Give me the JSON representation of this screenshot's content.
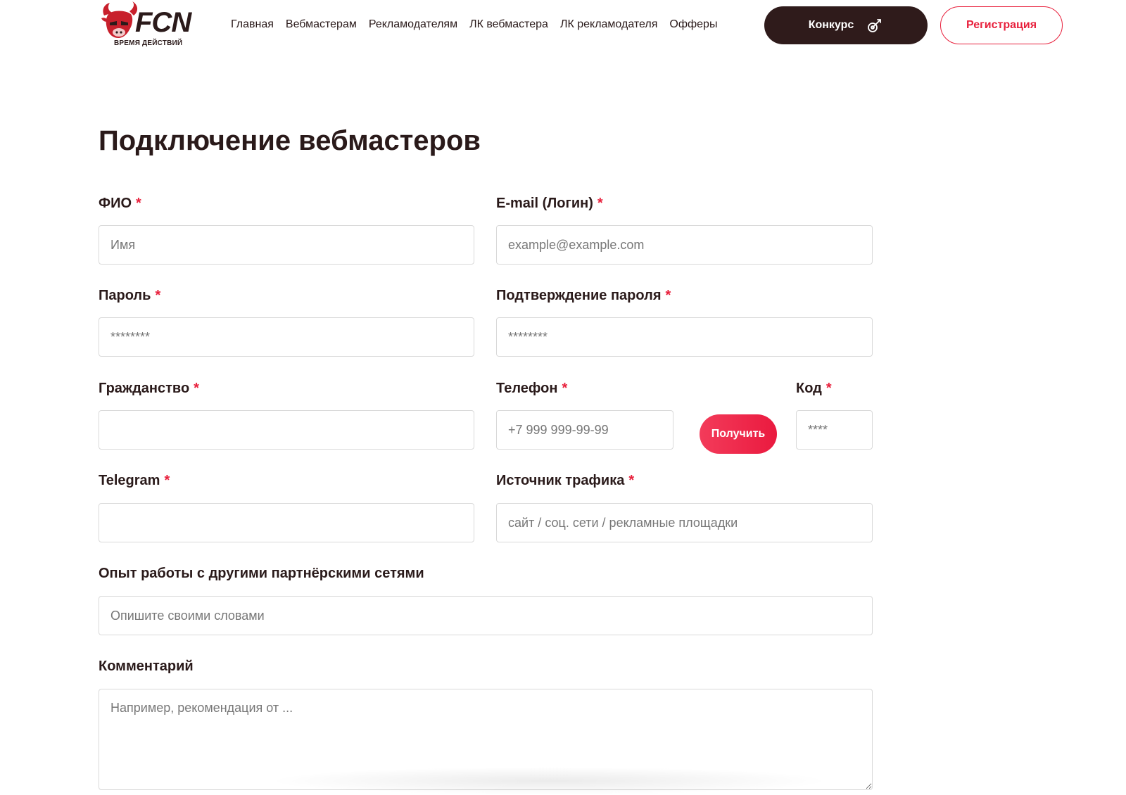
{
  "header": {
    "logo_text": "FCN",
    "logo_sub": "ВРЕМЯ ДЕЙСТВИЙ",
    "nav": [
      {
        "label": "Главная"
      },
      {
        "label": "Вебмастерам"
      },
      {
        "label": "Рекламодателям"
      },
      {
        "label": "ЛК вебмастера"
      },
      {
        "label": "ЛК рекламодателя"
      },
      {
        "label": "Офферы"
      }
    ],
    "contest_label": "Конкурс",
    "register_label": "Регистрация"
  },
  "page": {
    "title": "Подключение вебмастеров"
  },
  "form": {
    "required_mark": "*",
    "fio": {
      "label": "ФИО",
      "placeholder": "Имя",
      "value": ""
    },
    "email": {
      "label": "E-mail (Логин)",
      "placeholder": "example@example.com",
      "value": ""
    },
    "password": {
      "label": "Пароль",
      "placeholder": "********",
      "value": ""
    },
    "password_confirm": {
      "label": "Подтверждение пароля",
      "placeholder": "********",
      "value": ""
    },
    "citizenship": {
      "label": "Гражданство",
      "placeholder": "",
      "value": ""
    },
    "phone": {
      "label": "Телефон",
      "placeholder": "+7 999 999-99-99",
      "value": ""
    },
    "get_code_label": "Получить",
    "code": {
      "label": "Код",
      "placeholder": "****",
      "value": ""
    },
    "telegram": {
      "label": "Telegram",
      "placeholder": "",
      "value": ""
    },
    "traffic_source": {
      "label": "Источник трафика",
      "placeholder": "сайт / соц. сети / рекламные площадки",
      "value": ""
    },
    "experience": {
      "label": "Опыт работы с другими партнёрскими сетями",
      "placeholder": "Опишите своими словами",
      "value": ""
    },
    "comment": {
      "label": "Комментарий",
      "placeholder": "Например, рекомендация от ...",
      "value": ""
    }
  },
  "colors": {
    "brand_dark": "#2f1b1b",
    "accent_red": "#e8203c"
  }
}
